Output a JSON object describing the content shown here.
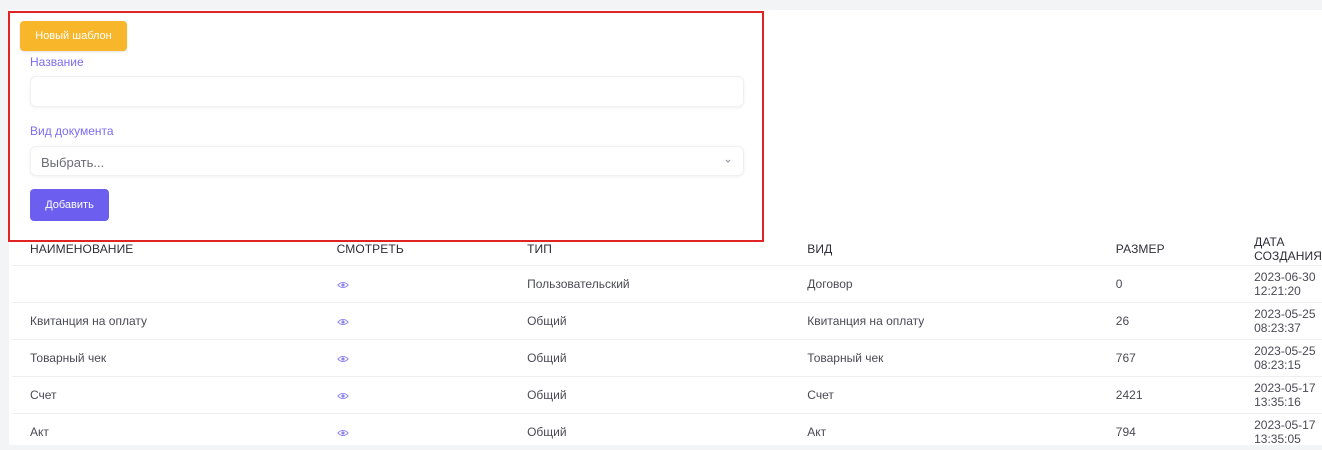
{
  "form": {
    "new_template_label": "Новый шаблон",
    "name_label": "Название",
    "name_value": "",
    "doc_type_label": "Вид документа",
    "doc_type_placeholder": "Выбрать...",
    "add_label": "Добавить"
  },
  "table": {
    "headers": [
      "НАИМЕНОВАНИЕ",
      "СМОТРЕТЬ",
      "ТИП",
      "ВИД",
      "РАЗМЕР",
      "ДАТА СОЗДАНИЯ"
    ],
    "rows": [
      {
        "name": "",
        "type": "Пользовательский",
        "kind": "Договор",
        "size": "0",
        "created": "2023-06-30 12:21:20"
      },
      {
        "name": "Квитанция на оплату",
        "type": "Общий",
        "kind": "Квитанция на оплату",
        "size": "26",
        "created": "2023-05-25 08:23:37"
      },
      {
        "name": "Товарный чек",
        "type": "Общий",
        "kind": "Товарный чек",
        "size": "767",
        "created": "2023-05-25 08:23:15"
      },
      {
        "name": "Счет",
        "type": "Общий",
        "kind": "Счет",
        "size": "2421",
        "created": "2023-05-17 13:35:16"
      },
      {
        "name": "Акт",
        "type": "Общий",
        "kind": "Акт",
        "size": "794",
        "created": "2023-05-17 13:35:05"
      }
    ]
  },
  "colors": {
    "new_template_button": "#f8b62a",
    "add_button": "#6c5ff0",
    "label_accent": "#7b6df0",
    "highlight_border": "#e02424",
    "eye_icon": "#8c84f0"
  },
  "icons": {
    "view": "eye-icon",
    "select_arrow": "chevron-down-icon"
  }
}
